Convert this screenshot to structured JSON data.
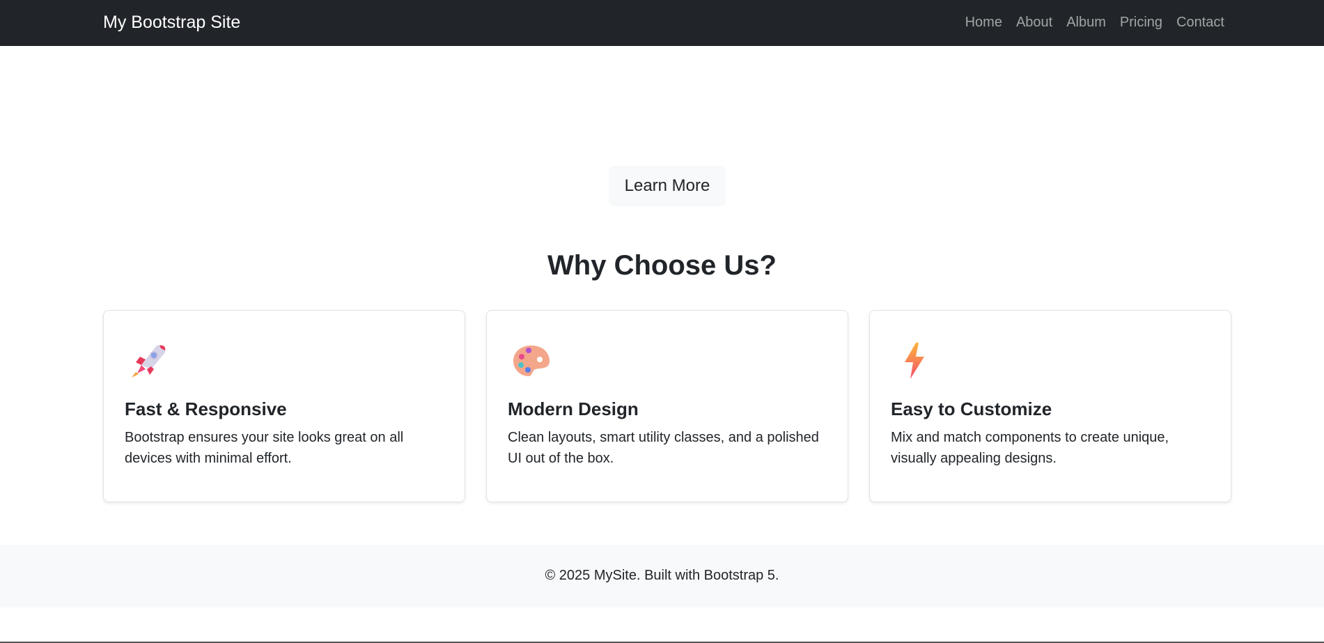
{
  "navbar": {
    "brand": "My Bootstrap Site",
    "links": [
      "Home",
      "About",
      "Album",
      "Pricing",
      "Contact"
    ]
  },
  "hero": {
    "button_label": "Learn More"
  },
  "features": {
    "title": "Why Choose Us?",
    "cards": [
      {
        "icon": "rocket-icon",
        "title": "Fast & Responsive",
        "text": "Bootstrap ensures your site looks great on all devices with minimal effort."
      },
      {
        "icon": "palette-icon",
        "title": "Modern Design",
        "text": "Clean layouts, smart utility classes, and a polished UI out of the box."
      },
      {
        "icon": "lightning-icon",
        "title": "Easy to Customize",
        "text": "Mix and match components to create unique, visually appealing designs."
      }
    ]
  },
  "footer": {
    "text": "© 2025 MySite. Built with Bootstrap 5."
  },
  "colors": {
    "navbar_bg": "#212529",
    "footer_bg": "#f8f9fa",
    "text": "#212529"
  }
}
